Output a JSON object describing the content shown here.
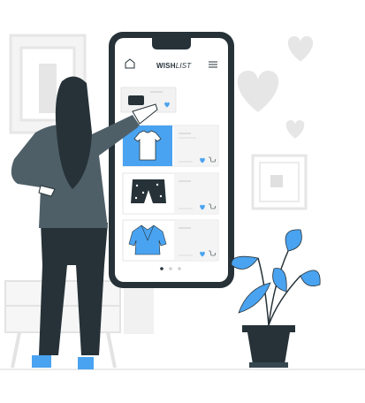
{
  "app": {
    "title_bold": "WISH",
    "title_italic": "LIST"
  },
  "colors": {
    "accent": "#4aa3f0",
    "dark": "#263238",
    "light_gray": "#e6e6e6",
    "mid_gray": "#cfcfcf",
    "background": "#ffffff"
  },
  "icons": {
    "home": "home-icon",
    "menu": "hamburger-menu-icon",
    "heart": "heart-icon",
    "cart": "cart-icon"
  },
  "wishlist_items": [
    {
      "product": "t-shirt",
      "highlighted": true
    },
    {
      "product": "shorts",
      "highlighted": false
    },
    {
      "product": "blouse",
      "highlighted": false
    }
  ],
  "pagination": {
    "pages": 3,
    "active": 0
  }
}
